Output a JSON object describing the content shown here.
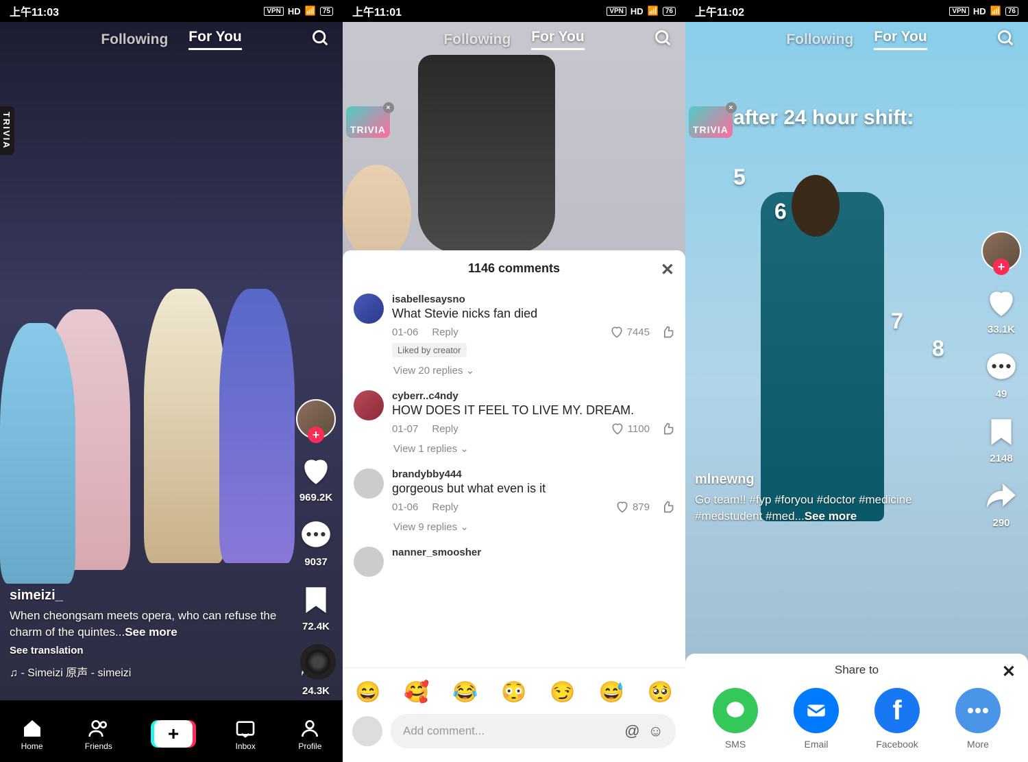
{
  "status": {
    "time1": "上午11:03",
    "time2": "上午11:01",
    "time3": "上午11:02",
    "vpn": "VPN",
    "hd": "HD",
    "battery1": "75",
    "battery2": "76",
    "battery3": "76"
  },
  "nav": {
    "following": "Following",
    "foryou": "For You"
  },
  "trivia": {
    "label": "TRIVIA"
  },
  "panel1": {
    "username": "simeizi_",
    "caption": "When cheongsam meets opera, who can refuse the charm of the quintes...",
    "see_more": "See more",
    "see_translation": "See translation",
    "music": "♫ - Simeizi  原声 - simeizi",
    "likes": "969.2K",
    "comments": "9037",
    "saves": "72.4K",
    "shares": "24.3K",
    "bottom_nav": {
      "home": "Home",
      "friends": "Friends",
      "inbox": "Inbox",
      "profile": "Profile"
    }
  },
  "panel2": {
    "comments_title": "1146 comments",
    "comments": [
      {
        "user": "isabellesaysno",
        "text": "What Stevie nicks fan died",
        "date": "01-06",
        "reply": "Reply",
        "likes": "7445",
        "liked_by_creator": "Liked by creator",
        "view_replies": "View 20 replies ⌄"
      },
      {
        "user": "cyberr..c4ndy",
        "text": "HOW DOES IT FEEL TO LIVE MY. DREAM.",
        "date": "01-07",
        "reply": "Reply",
        "likes": "1100",
        "view_replies": "View 1 replies ⌄"
      },
      {
        "user": "brandybby444",
        "text": "gorgeous but what even is it",
        "date": "01-06",
        "reply": "Reply",
        "likes": "879",
        "view_replies": "View 9 replies ⌄"
      },
      {
        "user": "nanner_smoosher",
        "text": ""
      }
    ],
    "emojis": [
      "😄",
      "🥰",
      "😂",
      "😳",
      "😏",
      "😅",
      "🥺"
    ],
    "input_placeholder": "Add comment..."
  },
  "panel3": {
    "overlay_text": "Me after 24 hour shift:",
    "numbers": [
      "5",
      "6",
      "7",
      "8"
    ],
    "username": "mlnewng",
    "caption": "Go team!! #fyp #foryou #doctor #medicine #medstudent #med...",
    "see_more": "See more",
    "likes": "33.1K",
    "comments": "49",
    "saves": "2148",
    "shares": "290",
    "share_title": "Share to",
    "share_options": {
      "sms": "SMS",
      "email": "Email",
      "facebook": "Facebook",
      "more": "More"
    }
  }
}
